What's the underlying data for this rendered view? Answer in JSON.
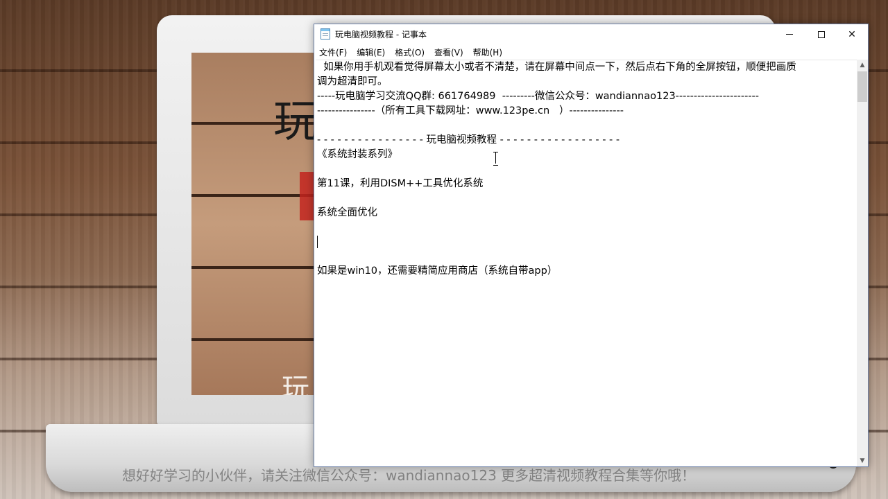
{
  "window": {
    "title": "玩电脑视频教程 - 记事本",
    "minimize_label": "minimize",
    "maximize_label": "maximize",
    "close_glyph": "✕"
  },
  "menu": [
    {
      "label": "文件(F)"
    },
    {
      "label": "编辑(E)"
    },
    {
      "label": "格式(O)"
    },
    {
      "label": "查看(V)"
    },
    {
      "label": "帮助(H)"
    }
  ],
  "editor": {
    "lines": [
      "  如果你用手机观看觉得屏幕太小或者不清楚，请在屏幕中间点一下，然后点右下角的全屏按钮，顺便把画质",
      "调为超清即可。",
      "-----玩电脑学习交流QQ群: 661764989  ---------微信公众号：wandiannao123-----------------------",
      "----------------（所有工具下载网址：www.123pe.cn   ）---------------",
      "",
      "- - - - - - - - - - - - - - - - 玩电脑视频教程 - - - - - - - - - - - - - - - - - -",
      "《系统封装系列》",
      "",
      "第11课，利用DISM++工具优化系统",
      "",
      "系统全面优化",
      "",
      "",
      "",
      "如果是win10，还需要精简应用商店（系统自带app）"
    ]
  },
  "scrollbar": {
    "up_glyph": "▲",
    "down_glyph": "▼"
  },
  "background": {
    "screen_glyph": "玩",
    "screen_glyph_bottom": "玩",
    "caption": "想好好学习的小伙伴，请关注微信公众号：wandiannao123 更多超清视频教程合集等你哦！"
  },
  "colors": {
    "window_border": "#6b7fa6",
    "editor_bg": "#ffffff",
    "scroll_track": "#f0f0f0"
  }
}
